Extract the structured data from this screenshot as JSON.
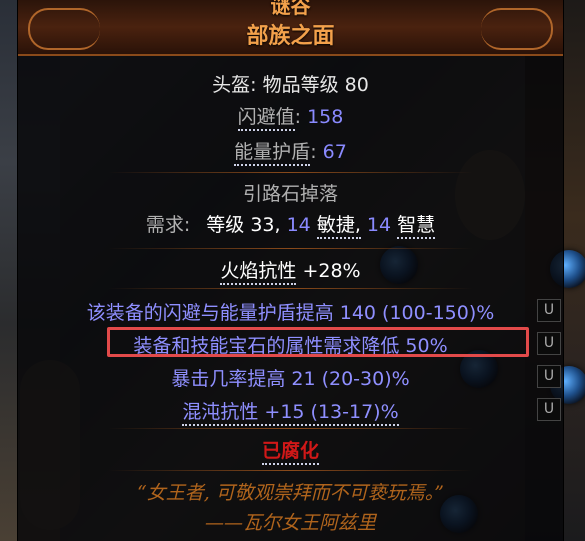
{
  "item": {
    "title_partial": "谜谷",
    "name": "部族之面",
    "base_label": "头盔: 物品等级 80",
    "evasion_label": "闪避值",
    "evasion_value": "158",
    "es_label": "能量护盾",
    "es_value": "67",
    "drop_label": "引路石掉落",
    "req_prefix": "需求:",
    "req_level_label": "等级",
    "req_level_value": "33,",
    "req_dex_value": "14",
    "req_dex_label": "敏捷,",
    "req_int_value": "14",
    "req_int_label": "智慧",
    "implicit_label": "火焰抗性",
    "implicit_value": "+28%",
    "mods": [
      "该装备的闪避与能量护盾提高 140 (100-150)%",
      "装备和技能宝石的属性需求降低 50%",
      "暴击几率提高 21 (20-30)%",
      "混沌抗性 +15 (13-17)%"
    ],
    "mod_tag": "U",
    "corrupted": "已腐化",
    "flavour_line1": "“女王者, 可敬观崇拜而不可亵玩焉。”",
    "flavour_line2": "——瓦尔女王阿兹里"
  },
  "colors": {
    "unique_name": "#f3a14b",
    "magic_blue": "#8f8fff",
    "corrupted_red": "#d01818",
    "flavour": "#b0641c",
    "highlight_box": "#e24a4a"
  }
}
